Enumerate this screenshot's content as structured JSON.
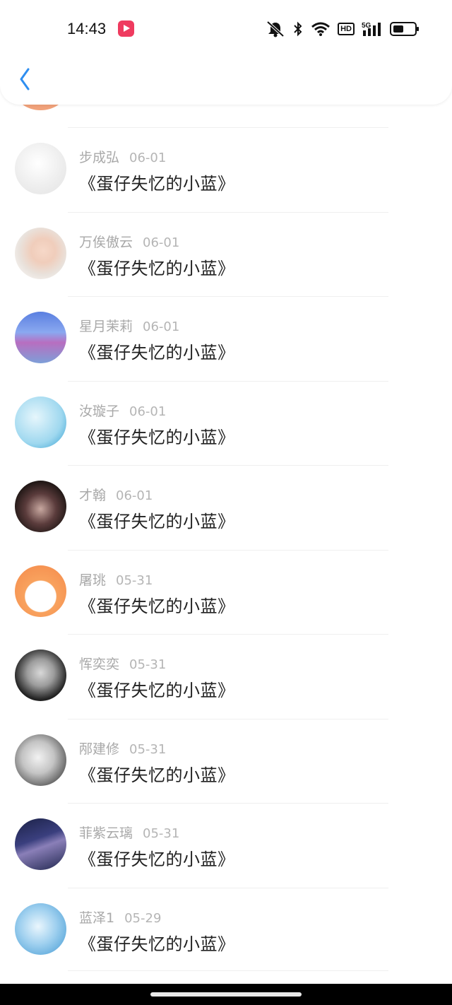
{
  "status_bar": {
    "time": "14:43",
    "hd_label": "HD",
    "network_label": "5G",
    "battery_level": 0.55
  },
  "header": {
    "back_icon": "chevron-left-icon",
    "accent": "#2e8ef0"
  },
  "comments": [
    {
      "name": "步成弘",
      "date": "06-01",
      "title": "《蛋仔失忆的小蓝》",
      "avatar": "cloud-avatar"
    },
    {
      "name": "万俟傲云",
      "date": "06-01",
      "title": "《蛋仔失忆的小蓝》",
      "avatar": "girl-avatar"
    },
    {
      "name": "星月茉莉",
      "date": "06-01",
      "title": "《蛋仔失忆的小蓝》",
      "avatar": "game-scene-avatar"
    },
    {
      "name": "汝璇子",
      "date": "06-01",
      "title": "《蛋仔失忆的小蓝》",
      "avatar": "snowflake-avatar"
    },
    {
      "name": "才翰",
      "date": "06-01",
      "title": "《蛋仔失忆的小蓝》",
      "avatar": "woman-avatar"
    },
    {
      "name": "屠珧",
      "date": "05-31",
      "title": "《蛋仔失忆的小蓝》",
      "avatar": "cartoon-dog-avatar"
    },
    {
      "name": "恽奕奕",
      "date": "05-31",
      "title": "《蛋仔失忆的小蓝》",
      "avatar": "boy-avatar"
    },
    {
      "name": "邴建修",
      "date": "05-31",
      "title": "《蛋仔失忆的小蓝》",
      "avatar": "bw-girl-avatar"
    },
    {
      "name": "菲紫云璃",
      "date": "05-31",
      "title": "《蛋仔失忆的小蓝》",
      "avatar": "anime-avatar"
    },
    {
      "name": "蓝泽1",
      "date": "05-29",
      "title": "《蛋仔失忆的小蓝》",
      "avatar": "anime-blue-avatar"
    }
  ]
}
